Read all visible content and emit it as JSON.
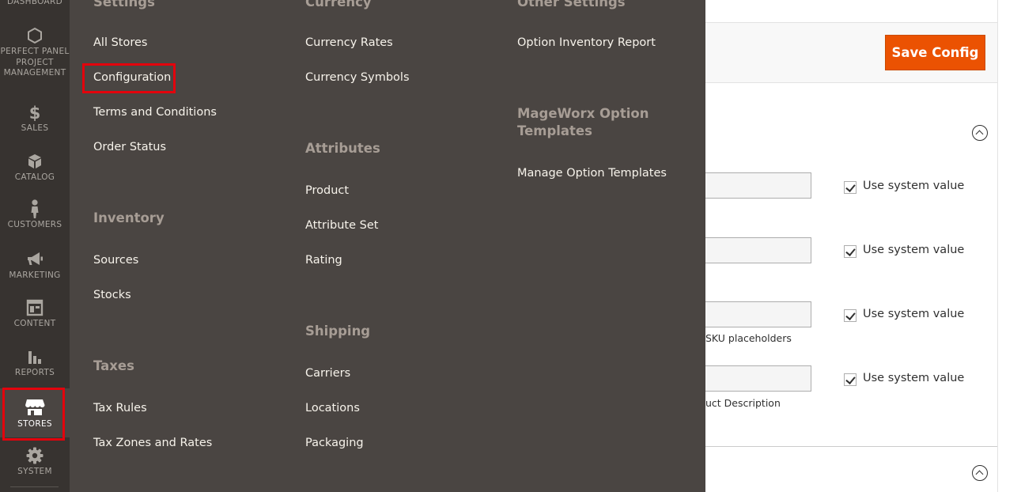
{
  "sidebar": {
    "items": [
      {
        "label": "Dashboard",
        "icon": "dashboard-icon"
      },
      {
        "label": "Perfect Panel Project Management",
        "icon": "hexagon-icon"
      },
      {
        "label": "Sales",
        "icon": "dollar-icon"
      },
      {
        "label": "Catalog",
        "icon": "cube-icon"
      },
      {
        "label": "Customers",
        "icon": "person-icon"
      },
      {
        "label": "Marketing",
        "icon": "megaphone-icon"
      },
      {
        "label": "Content",
        "icon": "layout-icon"
      },
      {
        "label": "Reports",
        "icon": "bar-chart-icon"
      },
      {
        "label": "Stores",
        "icon": "storefront-icon",
        "active": true
      },
      {
        "label": "System",
        "icon": "gear-icon"
      }
    ]
  },
  "flyout": {
    "col1": {
      "settings_title": "Settings",
      "settings_links": [
        "All Stores",
        "Configuration",
        "Terms and Conditions",
        "Order Status"
      ],
      "inventory_title": "Inventory",
      "inventory_links": [
        "Sources",
        "Stocks"
      ],
      "taxes_title": "Taxes",
      "taxes_links": [
        "Tax Rules",
        "Tax Zones and Rates"
      ]
    },
    "col2": {
      "currency_title": "Currency",
      "currency_links": [
        "Currency Rates",
        "Currency Symbols"
      ],
      "attributes_title": "Attributes",
      "attributes_links": [
        "Product",
        "Attribute Set",
        "Rating"
      ],
      "shipping_title": "Shipping",
      "shipping_links": [
        "Carriers",
        "Locations",
        "Packaging"
      ]
    },
    "col3": {
      "other_title": "Other Settings",
      "other_links": [
        "Option Inventory Report"
      ],
      "mageworx_title_line1": "MageWorx Option",
      "mageworx_title_line2": "Templates",
      "mageworx_links": [
        "Manage Option Templates"
      ]
    }
  },
  "page": {
    "save_button": "Save Config",
    "use_system_value": "Use system value",
    "note_sku": "SKU placeholders",
    "note_description": "uct Description"
  },
  "colors": {
    "sidebar_bg": "#373330",
    "flyout_bg": "#4a4542",
    "accent": "#eb5202",
    "highlight": "#e3030c"
  }
}
